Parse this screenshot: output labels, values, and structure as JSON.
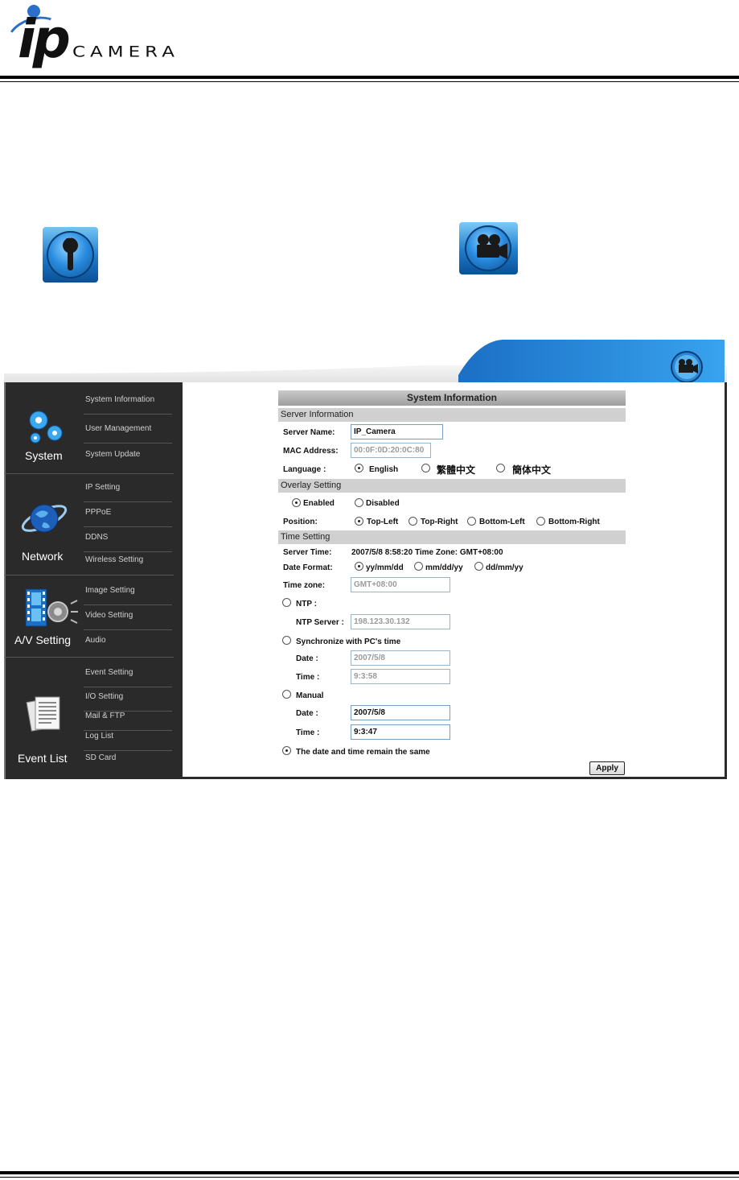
{
  "header": {
    "logo_ip": "ip",
    "logo_camera": "CAMERA"
  },
  "icons": {
    "big_left": "wrench-icon",
    "big_right": "camera-icon",
    "topbar": "camera-icon"
  },
  "sidebar": {
    "groups": [
      {
        "title": "System",
        "icon": "gear-icon",
        "items": [
          "System Information",
          "User Management",
          "System Update"
        ]
      },
      {
        "title": "Network",
        "icon": "globe-icon",
        "items": [
          "IP Setting",
          "PPPoE",
          "DDNS",
          "Wireless Setting"
        ]
      },
      {
        "title": "A/V Setting",
        "icon": "film-speaker-icon",
        "items": [
          "Image Setting",
          "Video Setting",
          "Audio"
        ]
      },
      {
        "title": "Event List",
        "icon": "documents-icon",
        "items": [
          "Event Setting",
          "I/O Setting",
          "Mail & FTP",
          "Log List",
          "SD Card"
        ]
      }
    ]
  },
  "panel": {
    "title": "System Information",
    "server_info": {
      "heading": "Server Information",
      "server_name_label": "Server Name:",
      "server_name_value": "IP_Camera",
      "mac_label": "MAC Address:",
      "mac_value": "00:0F:0D:20:0C:80",
      "language_label": "Language :",
      "language_options": [
        "English",
        "繁體中文",
        "簡体中文"
      ],
      "language_selected": "English"
    },
    "overlay": {
      "heading": "Overlay Setting",
      "options": [
        "Enabled",
        "Disabled"
      ],
      "selected": "Enabled",
      "position_label": "Position:",
      "positions": [
        "Top-Left",
        "Top-Right",
        "Bottom-Left",
        "Bottom-Right"
      ],
      "position_selected": "Top-Left"
    },
    "time": {
      "heading": "Time Setting",
      "server_time_label": "Server Time:",
      "server_time_value": "2007/5/8 8:58:20 Time Zone: GMT+08:00",
      "date_format_label": "Date Format:",
      "date_formats": [
        "yy/mm/dd",
        "mm/dd/yy",
        "dd/mm/yy"
      ],
      "date_format_selected": "yy/mm/dd",
      "timezone_label": "Time zone:",
      "timezone_value": "GMT+08:00",
      "ntp_label": "NTP :",
      "ntp_server_label": "NTP Server :",
      "ntp_server_value": "198.123.30.132",
      "sync_label": "Synchronize with PC's time",
      "sync_date_label": "Date :",
      "sync_date_value": "2007/5/8",
      "sync_time_label": "Time :",
      "sync_time_value": "9:3:58",
      "manual_label": "Manual",
      "manual_date_label": "Date :",
      "manual_date_value": "2007/5/8",
      "manual_time_label": "Time :",
      "manual_time_value": "9:3:47",
      "keep_label": "The date and time remain the same",
      "selected_mode": "keep"
    },
    "apply_label": "Apply"
  },
  "colors": {
    "sidebar_bg": "#2a2a2a",
    "accent_blue": "#1f7fd0",
    "section_gray": "#d0d0d0"
  }
}
